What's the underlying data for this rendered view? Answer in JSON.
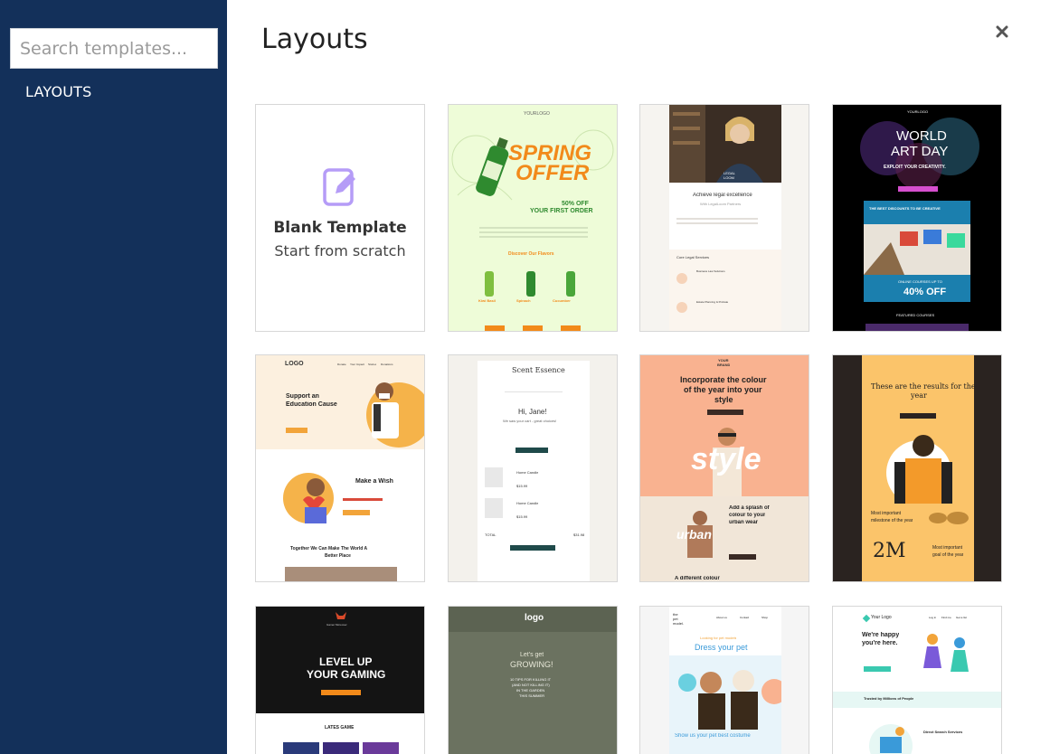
{
  "sidebar": {
    "search_placeholder": "Search templates...",
    "nav_layouts": "LAYOUTS"
  },
  "header": {
    "title": "Layouts",
    "close_icon": "close-icon"
  },
  "blank": {
    "title": "Blank Template",
    "subtitle": "Start from scratch",
    "icon": "edit-icon"
  },
  "templates": {
    "spring": {
      "logo": "YOURLOGO",
      "headline1": "SPRING",
      "headline2": "OFFER",
      "offer1": "50% OFF",
      "offer2": "YOUR FIRST ORDER",
      "section": "Discover Our Flavors",
      "f1": "Kiwi Basil",
      "f2": "Spinach",
      "f3": "Cucumber"
    },
    "legal": {
      "brand1": "LEGAL",
      "brand2": "LOOM",
      "headline": "Achieve legal excellence",
      "sub": "With LegalLoom Partners",
      "section": "Core Legal Services",
      "s1": "Business Law Solutions",
      "s2": "Estate Planning & Probate"
    },
    "art": {
      "logo": "YOURLOGO",
      "title1": "WORLD",
      "title2": "ART DAY",
      "tagline": "EXPLOIT YOUR CREATIVITY.",
      "banner": "THE BEST DISCOUNTS TO BE CREATIVE",
      "promo1": "ONLINE COURSES UP TO",
      "promo2": "40% OFF",
      "featured": "FEATURED COURSES"
    },
    "education": {
      "logo": "LOGO",
      "n1": "Donate",
      "n2": "Your Impact",
      "n3": "Stories",
      "n4": "Donations",
      "headline1": "Support an",
      "headline2": "Education Cause",
      "wish": "Make a Wish",
      "together1": "Together We Can Make The World A",
      "together2": "Better Place"
    },
    "scent": {
      "brand": "Scent Essence",
      "greeting": "Hi, Jane!",
      "sub": "We saw your cart - great choices!",
      "item1": "Home Candle",
      "price1": "$15.99",
      "item2": "Home Candle",
      "price2": "$15.99",
      "total": "TOTAL",
      "total_value": "$31.98"
    },
    "style": {
      "brand1": "YOUR",
      "brand2": "BRAND",
      "headline1": "Incorporate the colour",
      "headline2": "of the year into your",
      "headline3": "style",
      "big": "style",
      "urban": "urban",
      "splash1": "Add a splash of",
      "splash2": "colour to your",
      "splash3": "urban wear",
      "different": "A different colour"
    },
    "results": {
      "headline1": "These are the results for the",
      "headline2": "year",
      "stat_text1": "Most important",
      "stat_text2": "milestone of the year",
      "big_number": "2M",
      "stat_text3": "Most important",
      "stat_text4": "goal of the year"
    },
    "gaming": {
      "brand": "Gamer Moreover",
      "headline1": "LEVEL UP",
      "headline2": "YOUR GAMING",
      "section": "LATES GAME"
    },
    "growing": {
      "logo": "logo",
      "headline1": "Let's get",
      "headline2": "GROWING!",
      "sub1": "10 TIPS FOR KILLING IT",
      "sub2": "(AND NOT KILLING IT)",
      "sub3": "IN THE GARDEN",
      "sub4": "THIS SUMMER"
    },
    "pet": {
      "brand1": "the",
      "brand2": "pet",
      "brand3": "model.",
      "n1": "About us",
      "n2": "Contact",
      "n3": "Shop",
      "kicker": "Looking for pet models",
      "headline": "Dress your pet",
      "footer": "Show us your pet best costume"
    },
    "search": {
      "logo": "Your Logo",
      "n1": "Log in",
      "n2": "Find me",
      "n3": "Get a list",
      "headline1": "We're happy",
      "headline2": "you're here.",
      "trusted": "Trusted by Millions of People",
      "services": "Direct Search Services"
    }
  },
  "colors": {
    "sidebar_bg": "#13305a",
    "accent_purple": "#a78bfa",
    "spring_bg": "#eefcd8",
    "spring_orange": "#f28a1a",
    "spring_green": "#2f8a2f"
  }
}
